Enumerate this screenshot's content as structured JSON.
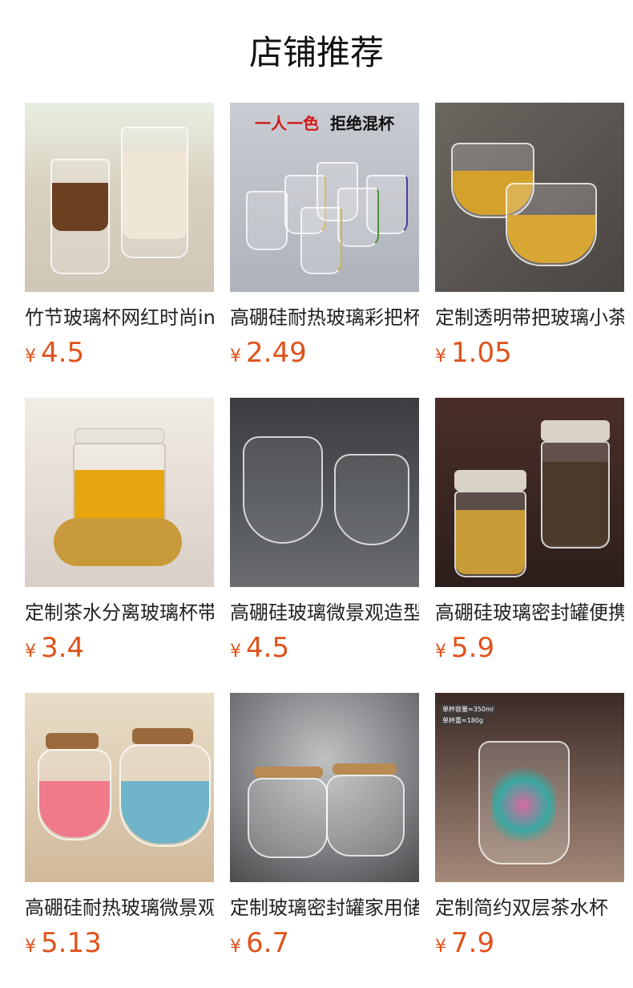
{
  "page": {
    "title": "店铺推荐"
  },
  "products": [
    {
      "name": "竹节玻璃杯网红时尚ins",
      "currency": "¥",
      "price": "4.5"
    },
    {
      "name": "高硼硅耐热玻璃彩把杯",
      "currency": "¥",
      "price": "2.49"
    },
    {
      "name": "定制透明带把玻璃小茶杯",
      "currency": "¥",
      "price": "1.05"
    },
    {
      "name": "定制茶水分离玻璃杯带盖",
      "currency": "¥",
      "price": "3.4"
    },
    {
      "name": "高硼硅玻璃微景观造型杯",
      "currency": "¥",
      "price": "4.5"
    },
    {
      "name": "高硼硅玻璃密封罐便携式",
      "currency": "¥",
      "price": "5.9"
    },
    {
      "name": "高硼硅耐热玻璃微景观瓶",
      "currency": "¥",
      "price": "5.13"
    },
    {
      "name": "定制玻璃密封罐家用储物",
      "currency": "¥",
      "price": "6.7"
    },
    {
      "name": "定制简约双层茶水杯",
      "currency": "¥",
      "price": "7.9"
    }
  ],
  "image_text": {
    "promo_part1": "一人一色",
    "promo_part2": "拒绝混杯",
    "spec_volume": "单杯容量≈350ml",
    "spec_weight": "单杯重≈180g"
  },
  "colors": {
    "price": "#e0521b",
    "title": "#111111"
  }
}
